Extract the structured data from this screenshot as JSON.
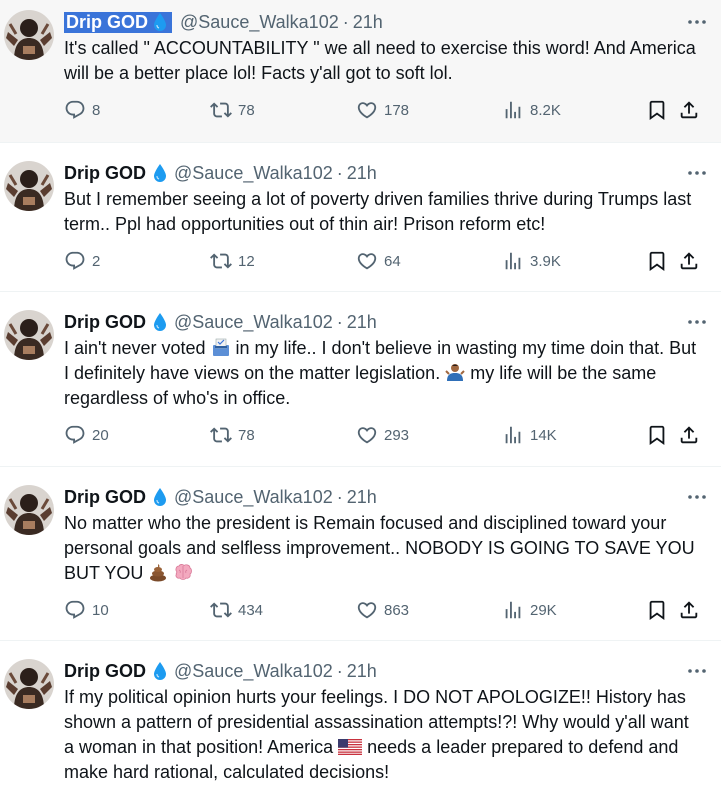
{
  "tweets": [
    {
      "name": "Drip GOD",
      "handle": "@Sauce_Walka102",
      "dot": "·",
      "time": "21h",
      "highlighted": true,
      "text": "It's called \" ACCOUNTABILITY \" we all need to exercise this word! And America will be a better place lol! Facts y'all got to soft lol.",
      "replies": "8",
      "retweets": "78",
      "likes": "178",
      "views": "8.2K"
    },
    {
      "name": "Drip GOD",
      "handle": "@Sauce_Walka102",
      "dot": "·",
      "time": "21h",
      "text": "But I remember seeing a lot of poverty driven families thrive during Trumps last term.. Ppl had opportunities out of thin air! Prison reform etc!",
      "replies": "2",
      "retweets": "12",
      "likes": "64",
      "views": "3.9K"
    },
    {
      "name": "Drip GOD",
      "handle": "@Sauce_Walka102",
      "dot": "·",
      "time": "21h",
      "text_parts": [
        "I ain't never voted ",
        " in my life.. I don't believe in wasting my time doin that. But I definitely have views on the matter legislation. ",
        " my life will be the same regardless of who's in office."
      ],
      "emojis": [
        "ballot-box-emoji",
        "person-shrugging-emoji"
      ],
      "replies": "20",
      "retweets": "78",
      "likes": "293",
      "views": "14K"
    },
    {
      "name": "Drip GOD",
      "handle": "@Sauce_Walka102",
      "dot": "·",
      "time": "21h",
      "text_parts": [
        "No matter who the president is Remain focused and disciplined toward your personal goals and selfless improvement.. NOBODY IS GOING TO SAVE YOU BUT YOU "
      ],
      "emojis": [
        "poop-emoji",
        "brain-emoji"
      ],
      "replies": "10",
      "retweets": "434",
      "likes": "863",
      "views": "29K"
    },
    {
      "name": "Drip GOD",
      "handle": "@Sauce_Walka102",
      "dot": "·",
      "time": "21h",
      "text_parts": [
        "If my political opinion hurts your feelings. I DO NOT APOLOGIZE!! History has shown a pattern of presidential assassination attempts!?! Why would y'all want a woman in that position! America ",
        " needs a leader prepared to defend and make hard rational, calculated decisions!"
      ],
      "emojis": [
        "us-flag-emoji"
      ]
    }
  ],
  "colors": {
    "text": "#0f1419",
    "secondary": "#536471",
    "drop": "#1d9bf0",
    "highlight_bg": "#f7f7f7",
    "selection": "#3a74d9"
  },
  "icons": [
    "reply-icon",
    "retweet-icon",
    "like-icon",
    "views-icon",
    "bookmark-icon",
    "share-icon",
    "more-icon",
    "water-drop-icon"
  ]
}
